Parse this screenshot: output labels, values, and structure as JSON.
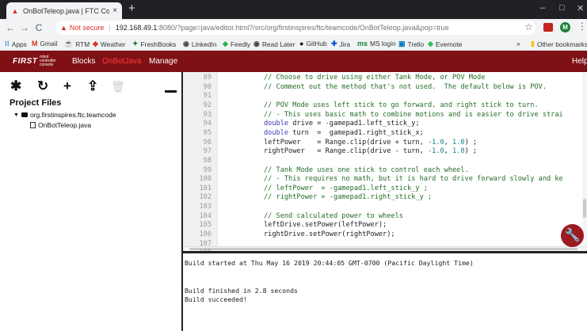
{
  "browser": {
    "tab_title": "OnBotTeleop.java | FTC Code Edi",
    "tab_close": "×",
    "new_tab": "+",
    "win_min": "–",
    "win_max": "□",
    "win_close": "✕",
    "security_label": "Not secure",
    "separator": "|",
    "url_host": "192.168.49.1",
    "url_path": ":8080/?page=java/editor.html?/src/org/firstinspires/ftc/teamcode/OnBotTeleop.java&pop=true",
    "profile_initial": "M"
  },
  "bookmarks": [
    {
      "label": "Apps",
      "icon": "apps-grid-icon",
      "glyph": "⁝⁝",
      "color": "#1a73e8"
    },
    {
      "label": "Gmail",
      "icon": "gmail-icon",
      "glyph": "M",
      "color": "#d93025"
    },
    {
      "label": "RTM",
      "icon": "rtm-icon",
      "glyph": "☕",
      "color": "#555555"
    },
    {
      "label": "Weather",
      "icon": "weather-icon",
      "glyph": "◆",
      "color": "#d93025"
    },
    {
      "label": "FreshBooks",
      "icon": "freshbooks-icon",
      "glyph": "✦",
      "color": "#188038"
    },
    {
      "label": "LinkedIn",
      "icon": "linkedin-icon",
      "glyph": "◉",
      "color": "#444444"
    },
    {
      "label": "Feedly",
      "icon": "feedly-icon",
      "glyph": "◆",
      "color": "#2bb24c"
    },
    {
      "label": "Read Later",
      "icon": "read-later-icon",
      "glyph": "◉",
      "color": "#444444"
    },
    {
      "label": "GitHub",
      "icon": "github-icon",
      "glyph": "●",
      "color": "#111111"
    },
    {
      "label": "Jira",
      "icon": "jira-icon",
      "glyph": "✚",
      "color": "#0052cc"
    },
    {
      "label": "MS login",
      "icon": "ms-login-icon",
      "glyph": "ms",
      "color": "#188038"
    },
    {
      "label": "Trello",
      "icon": "trello-icon",
      "glyph": "▣",
      "color": "#0079bf"
    },
    {
      "label": "Evernote",
      "icon": "evernote-icon",
      "glyph": "◆",
      "color": "#2dbe60"
    },
    {
      "label": "»",
      "icon": "overflow-chevron-icon",
      "glyph": "",
      "color": "#333333"
    },
    {
      "label": "Other bookmarks",
      "icon": "folder-icon",
      "glyph": "▮",
      "color": "#f5c518"
    }
  ],
  "app": {
    "logo": "FIRST",
    "logo_sub": "robot controller console",
    "nav": [
      "Blocks",
      "OnBotJava",
      "Manage"
    ],
    "help": "Help",
    "header_color": "#7f1015",
    "active_nav_color": "#ff3b3b"
  },
  "toolbar": {
    "settings_glyph": "✱",
    "undo_glyph": "↻",
    "add_glyph": "+",
    "upload_glyph": "⇪",
    "delete_glyph": "🗑"
  },
  "project": {
    "title": "Project Files",
    "package": "org.firstinspires.ftc.teamcode",
    "file": "OnBotTeleop.java"
  },
  "editor": {
    "lines": [
      {
        "n": "89",
        "text": "// Choose to drive using either Tank Mode, or POV Mode"
      },
      {
        "n": "90",
        "text": "// Comment out the method that's not used.  The default below is POV."
      },
      {
        "n": "91",
        "text": ""
      },
      {
        "n": "92",
        "text": "// POV Mode uses left stick to go forward, and right stick to turn."
      },
      {
        "n": "93",
        "text": "// - This uses basic math to combine motions and is easier to drive strai"
      },
      {
        "n": "94",
        "text": "double drive = -gamepad1.left_stick_y;"
      },
      {
        "n": "95",
        "text": "double turn  =  gamepad1.right_stick_x;"
      },
      {
        "n": "96",
        "text": "leftPower    = Range.clip(drive + turn, -1.0, 1.0) ;"
      },
      {
        "n": "97",
        "text": "rightPower   = Range.clip(drive - turn, -1.0, 1.0) ;"
      },
      {
        "n": "98",
        "text": ""
      },
      {
        "n": "99",
        "text": "// Tank Mode uses one stick to control each wheel."
      },
      {
        "n": "100",
        "text": "// - This requires no math, but it is hard to drive forward slowly and ke"
      },
      {
        "n": "101",
        "text": "// leftPower  = -gamepad1.left_stick_y ;"
      },
      {
        "n": "102",
        "text": "// rightPower = -gamepad1.right_stick_y ;"
      },
      {
        "n": "103",
        "text": ""
      },
      {
        "n": "104",
        "text": "// Send calculated power to wheels"
      },
      {
        "n": "105",
        "text": "leftDrive.setPower(leftPower);"
      },
      {
        "n": "106",
        "text": "rightDrive.setPower(rightPower);"
      },
      {
        "n": "107",
        "text": ""
      },
      {
        "n": "108",
        "text": ""
      }
    ],
    "fab_glyph": "🔧"
  },
  "output": {
    "lines": [
      "Build started at Thu May 16 2019 20:44:05 GMT-0700 (Pacific Daylight Time)",
      "",
      "",
      "Build finished in 2.8 seconds",
      "Build succeeded!"
    ]
  }
}
